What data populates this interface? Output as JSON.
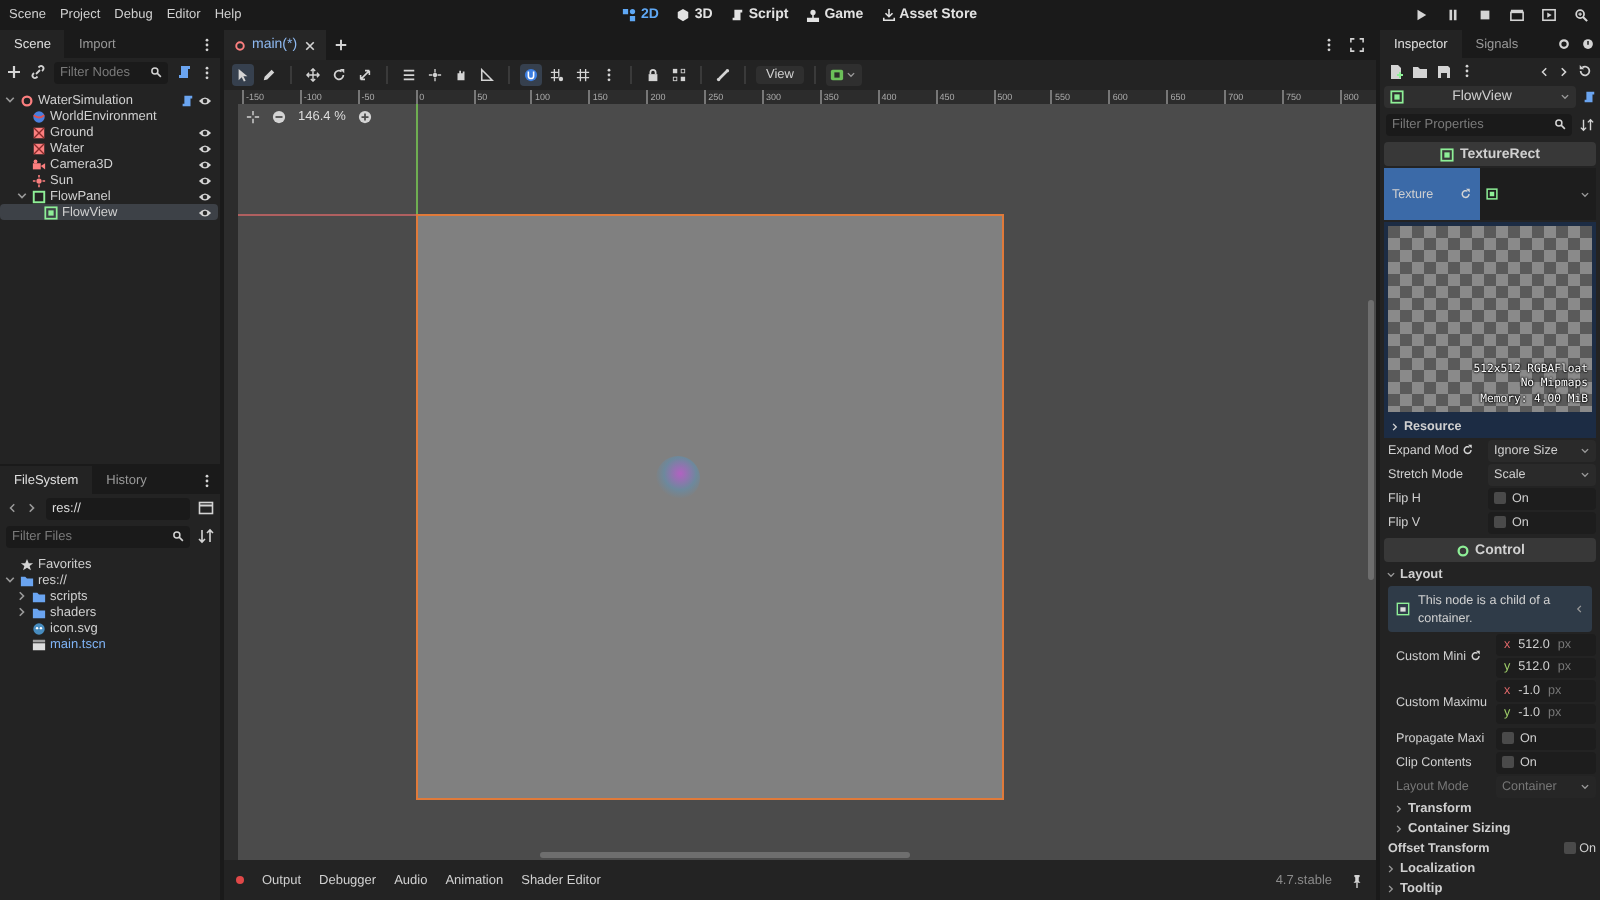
{
  "menu": [
    "Scene",
    "Project",
    "Debug",
    "Editor",
    "Help"
  ],
  "workspaces": [
    {
      "label": "2D",
      "kind": "planar",
      "selected": true
    },
    {
      "label": "3D",
      "kind": "spatial",
      "selected": false
    },
    {
      "label": "Script",
      "kind": "script",
      "selected": false
    },
    {
      "label": "Game",
      "kind": "game",
      "selected": false
    },
    {
      "label": "Asset Store",
      "kind": "assets",
      "selected": false
    }
  ],
  "scene_dock": {
    "tabs": [
      {
        "label": "Scene",
        "selected": true
      },
      {
        "label": "Import",
        "selected": false
      }
    ],
    "filter": {
      "placeholder": "Filter Nodes"
    },
    "tree": [
      {
        "name": "WaterSimulation",
        "kind": "node3d",
        "expanded": true,
        "selected": false,
        "visible": true,
        "script": true,
        "children": [
          {
            "name": "WorldEnvironment",
            "kind": "environment",
            "selected": false
          },
          {
            "name": "Ground",
            "kind": "mesh",
            "selected": false,
            "visible": true
          },
          {
            "name": "Water",
            "kind": "mesh",
            "selected": false,
            "visible": true
          },
          {
            "name": "Camera3D",
            "kind": "camera",
            "selected": false,
            "visible": true
          },
          {
            "name": "Sun",
            "kind": "light",
            "selected": false,
            "visible": true
          },
          {
            "name": "FlowPanel",
            "kind": "panel",
            "expanded": true,
            "selected": false,
            "visible": true,
            "children": [
              {
                "name": "FlowView",
                "kind": "texture_rect",
                "selected": true,
                "visible": true
              }
            ]
          }
        ]
      }
    ]
  },
  "filesystem": {
    "tabs": [
      {
        "label": "FileSystem",
        "selected": true
      },
      {
        "label": "History",
        "selected": false
      }
    ],
    "path": "res://",
    "filter": {
      "placeholder": "Filter Files"
    },
    "tree": [
      {
        "name": "Favorites",
        "kind": "favorites"
      },
      {
        "name": "res://",
        "kind": "folder",
        "expanded": true,
        "children": [
          {
            "name": "scripts",
            "kind": "folder",
            "expanded": false
          },
          {
            "name": "shaders",
            "kind": "folder",
            "expanded": false
          },
          {
            "name": "icon.svg",
            "kind": "image",
            "open": false
          },
          {
            "name": "main.tscn",
            "kind": "scene",
            "open": true
          }
        ]
      }
    ]
  },
  "editor_tabs": [
    {
      "label": "main(*)",
      "selected": true
    }
  ],
  "toolbar": [
    {
      "kind": "pointer",
      "selected": true
    },
    {
      "kind": "pencil",
      "selected": false
    },
    {
      "kind": "separator"
    },
    {
      "kind": "move",
      "selected": false
    },
    {
      "kind": "rotate",
      "selected": false
    },
    {
      "kind": "scale",
      "selected": false
    },
    {
      "kind": "separator"
    },
    {
      "kind": "list",
      "selected": false
    },
    {
      "kind": "pivot",
      "selected": false
    },
    {
      "kind": "hand",
      "selected": false
    },
    {
      "kind": "ruler",
      "selected": false
    },
    {
      "kind": "separator"
    },
    {
      "kind": "magnet",
      "selected": true
    },
    {
      "kind": "gridsnap",
      "selected": false
    },
    {
      "kind": "grid",
      "selected": false
    },
    {
      "kind": "dots",
      "selected": false
    },
    {
      "kind": "separator"
    },
    {
      "kind": "lock",
      "selected": false
    },
    {
      "kind": "group",
      "selected": false
    },
    {
      "kind": "separator"
    },
    {
      "kind": "bone",
      "selected": false
    },
    {
      "kind": "separator"
    },
    {
      "kind": "menu",
      "label": "View"
    },
    {
      "kind": "separator"
    },
    {
      "kind": "preview"
    }
  ],
  "viewport": {
    "zoom": "146.4 %",
    "ruler": [
      "-150",
      "-100",
      "-50",
      "0",
      "50",
      "100",
      "150",
      "200",
      "250",
      "300",
      "350",
      "400",
      "450",
      "500",
      "550",
      "600",
      "650",
      "700",
      "750",
      "800"
    ]
  },
  "bottom_panel": {
    "tabs": [
      {
        "label": "Output",
        "alert": true
      },
      {
        "label": "Debugger",
        "alert": false
      },
      {
        "label": "Audio",
        "alert": false
      },
      {
        "label": "Animation",
        "alert": false
      },
      {
        "label": "Shader Editor",
        "alert": false
      }
    ],
    "version": "4.7.stable"
  },
  "inspector": {
    "tabs": [
      {
        "label": "Inspector",
        "selected": true
      },
      {
        "label": "Signals",
        "selected": false
      }
    ],
    "node": {
      "name": "FlowView",
      "kind": "texture_rect"
    },
    "filter": {
      "placeholder": "Filter Properties"
    },
    "properties": [
      {
        "kind": "category",
        "label": "TextureRect"
      },
      {
        "kind": "texture",
        "label": "Texture",
        "selected": true,
        "revert": true,
        "preview": [
          "512x512 RGBAFloat",
          "No Mipmaps",
          "Memory: 4.00 MiB"
        ],
        "resource": {
          "label": "Resource",
          "expanded": false
        }
      },
      {
        "kind": "dropdown",
        "label": "Expand Mod",
        "revert": true,
        "value": "Ignore Size",
        "disabled": false
      },
      {
        "kind": "dropdown",
        "label": "Stretch Mode",
        "value": "Scale",
        "disabled": false
      },
      {
        "kind": "checkbox",
        "label": "Flip H",
        "checked": false,
        "text": "On"
      },
      {
        "kind": "checkbox",
        "label": "Flip V",
        "checked": false,
        "text": "On"
      },
      {
        "kind": "category",
        "label": "Control"
      },
      {
        "kind": "group",
        "label": "Layout",
        "expanded": true,
        "children": [
          {
            "kind": "note",
            "text": "This node is a child of a container."
          },
          {
            "kind": "vector",
            "label": "Custom Mini",
            "revert": true,
            "components": [
              {
                "axis": "x",
                "value": "512.0",
                "unit": "px"
              },
              {
                "axis": "y",
                "value": "512.0",
                "unit": "px"
              }
            ]
          },
          {
            "kind": "vector",
            "label": "Custom Maximu",
            "components": [
              {
                "axis": "x",
                "value": "-1.0",
                "unit": "px"
              },
              {
                "axis": "y",
                "value": "-1.0",
                "unit": "px"
              }
            ]
          },
          {
            "kind": "checkbox",
            "label": "Propagate Maxi",
            "checked": false,
            "text": "On"
          },
          {
            "kind": "checkbox",
            "label": "Clip Contents",
            "checked": false,
            "text": "On"
          },
          {
            "kind": "dropdown",
            "label": "Layout Mode",
            "value": "Container",
            "disabled": true
          },
          {
            "kind": "group",
            "label": "Transform",
            "expanded": false
          },
          {
            "kind": "group",
            "label": "Container Sizing",
            "expanded": false
          }
        ]
      },
      {
        "kind": "inline_check",
        "label": "Offset Transform",
        "checked": false,
        "text": "On"
      },
      {
        "kind": "group",
        "label": "Localization",
        "expanded": false
      },
      {
        "kind": "group",
        "label": "Tooltip",
        "expanded": false
      }
    ]
  }
}
